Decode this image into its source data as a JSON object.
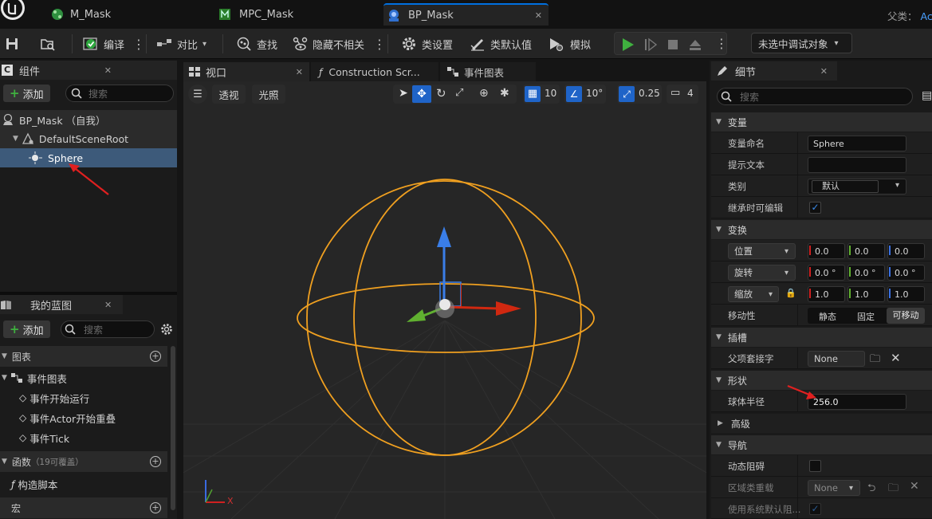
{
  "tabs": [
    {
      "label": "M_Mask"
    },
    {
      "label": "MPC_Mask"
    },
    {
      "label": "BP_Mask"
    }
  ],
  "parent_class": {
    "label": "父类：",
    "value": "Ac"
  },
  "toolbar": {
    "compile": "编译",
    "diff": "对比",
    "find": "查找",
    "hide_unrelated": "隐藏不相关",
    "class_settings": "类设置",
    "class_defaults": "类默认值",
    "simulate": "模拟",
    "debug_object": "未选中调试对象"
  },
  "components": {
    "title": "组件",
    "add": "添加",
    "search_placeholder": "搜索",
    "items": [
      {
        "label": "BP_Mask （自我）"
      },
      {
        "label": "DefaultSceneRoot"
      },
      {
        "label": "Sphere"
      }
    ]
  },
  "my_blueprint": {
    "title": "我的蓝图",
    "add": "添加",
    "search_placeholder": "搜索",
    "graphs_label": "图表",
    "event_graph": "事件图表",
    "events": [
      "事件开始运行",
      "事件Actor开始重叠",
      "事件Tick"
    ],
    "functions_label": "函数",
    "functions_count": "（19可覆盖）",
    "construction_script": "构造脚本",
    "macros_label": "宏"
  },
  "center_tabs": {
    "viewport": "视口",
    "construction": "Construction Scr...",
    "event_graph": "事件图表"
  },
  "viewport": {
    "perspective": "透视",
    "lit": "光照",
    "grid_snap": "10",
    "rot_snap": "10°",
    "scale_snap": "0.25",
    "cam_speed": "4",
    "axis_x": "X"
  },
  "details": {
    "title": "细节",
    "search_placeholder": "搜索",
    "cat_variable": "变量",
    "var_name_label": "变量命名",
    "var_name": "Sphere",
    "tooltip_label": "提示文本",
    "tooltip": "",
    "category_label": "类别",
    "category": "默认",
    "editable_label": "继承时可编辑",
    "cat_transform": "变换",
    "location": "位置",
    "rotation": "旋转",
    "scale": "缩放",
    "loc": [
      "0.0",
      "0.0",
      "0.0"
    ],
    "rot": [
      "0.0 °",
      "0.0 °",
      "0.0 °"
    ],
    "scl": [
      "1.0",
      "1.0",
      "1.0"
    ],
    "mobility_label": "移动性",
    "mobility": [
      "静态",
      "固定",
      "可移动"
    ],
    "cat_sockets": "插槽",
    "parent_socket_label": "父项套接字",
    "parent_socket": "None",
    "cat_shape": "形状",
    "sphere_radius_label": "球体半径",
    "sphere_radius": "256.0",
    "cat_advanced": "高级",
    "cat_navigation": "导航",
    "dynamic_obstacle_label": "动态阻碍",
    "area_class_label": "区域类重载",
    "area_class": "None",
    "use_sys_default_label": "使用系统默认阻..."
  },
  "colors": {
    "accent": "#0070e0",
    "play_green": "#3fb03f",
    "sphere_orange": "#f0a020",
    "annotation_red": "#e02020"
  }
}
